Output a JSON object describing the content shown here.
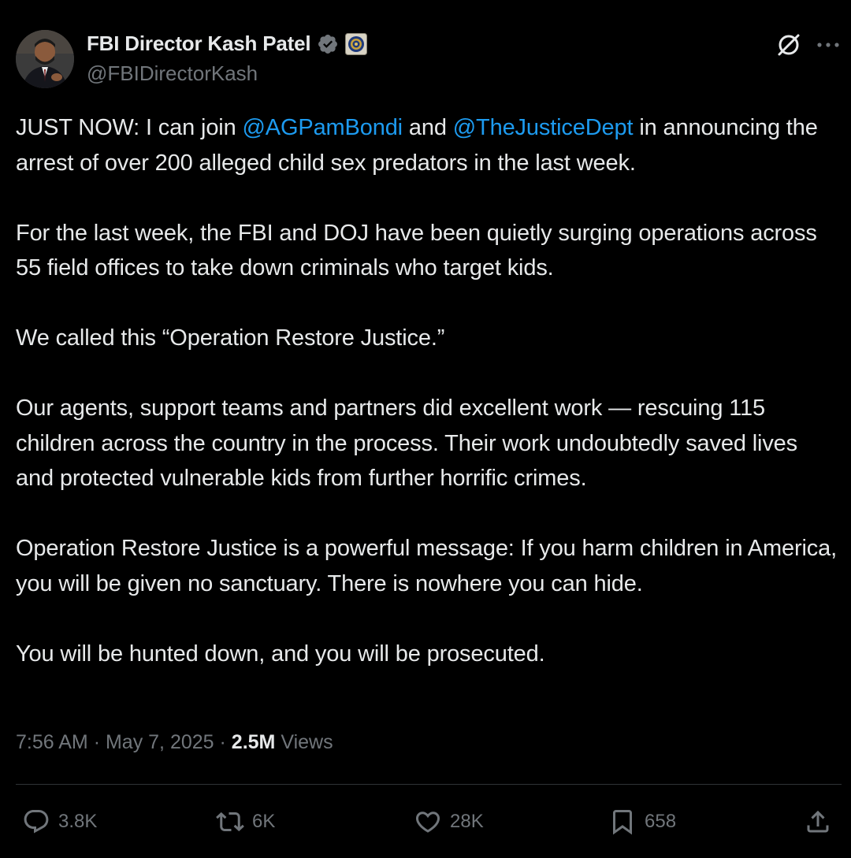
{
  "author": {
    "display_name": "FBI Director Kash Patel",
    "handle": "@FBIDirectorKash",
    "verified": true,
    "affiliation_badge": "fbi-seal-icon"
  },
  "post": {
    "paragraphs": [
      [
        {
          "text": "JUST NOW: I can join "
        },
        {
          "text": "@AGPamBondi",
          "mention": true
        },
        {
          "text": " and "
        },
        {
          "text": "@TheJusticeDept",
          "mention": true
        },
        {
          "text": " in announcing the arrest of over 200 alleged child sex predators in the last week."
        }
      ],
      [
        {
          "text": "For the last week, the FBI and DOJ have been quietly surging operations across 55 field offices to take down criminals who target kids."
        }
      ],
      [
        {
          "text": "We called this “Operation Restore Justice.”"
        }
      ],
      [
        {
          "text": "Our agents, support teams and partners did excellent work — rescuing 115 children across the country in the process. Their work undoubtedly saved lives and protected vulnerable kids from further horrific crimes."
        }
      ],
      [
        {
          "text": "Operation Restore Justice is a powerful message: If you harm children in America, you will be given no sanctuary. There is nowhere you can hide."
        }
      ],
      [
        {
          "text": "You will be hunted down, and you will be prosecuted."
        }
      ]
    ],
    "time": "7:56 AM",
    "separator": "·",
    "date": "May 7, 2025",
    "views_count": "2.5M",
    "views_label": "Views"
  },
  "actions": {
    "replies": "3.8K",
    "reposts": "6K",
    "likes": "28K",
    "bookmarks": "658"
  },
  "colors": {
    "background": "#000000",
    "text": "#e7e9ea",
    "secondary": "#71767b",
    "accent": "#1d9bf0",
    "divider": "#2f3336"
  }
}
